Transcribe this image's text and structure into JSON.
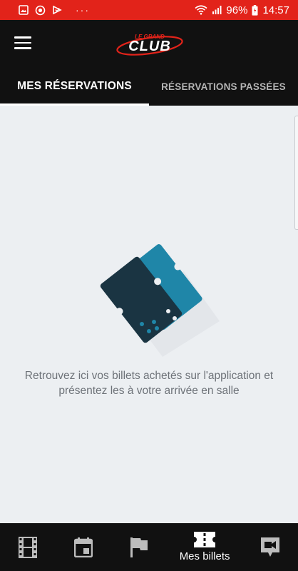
{
  "status_bar": {
    "battery": "96%",
    "time": "14:57",
    "dots": "···",
    "icons": [
      "image-icon",
      "app-icon",
      "download-icon",
      "wifi-icon",
      "signal-icon",
      "battery-icon"
    ]
  },
  "header": {
    "menu_icon": "hamburger-icon",
    "logo_top": "LE GRAND",
    "logo_main": "CLUB"
  },
  "tabs": [
    {
      "label": "MES RÉSERVATIONS",
      "active": true
    },
    {
      "label": "RÉSERVATIONS PASSÉES",
      "active": false
    }
  ],
  "main": {
    "empty_message_line1": "Retrouvez ici vos billets achetés sur l'application et",
    "empty_message_line2": "présentez les à votre arrivée en salle",
    "illustration_icon": "tickets-illustration"
  },
  "bottom_nav": [
    {
      "icon": "film-icon",
      "label": ""
    },
    {
      "icon": "calendar-icon",
      "label": ""
    },
    {
      "icon": "flag-icon",
      "label": ""
    },
    {
      "icon": "ticket-icon",
      "label": "Mes billets",
      "active": true
    },
    {
      "icon": "video-chat-icon",
      "label": ""
    }
  ],
  "colors": {
    "status_bar": "#e2231a",
    "header": "#111111",
    "background": "#eceff2",
    "ticket_dark": "#1a3442",
    "ticket_blue": "#1f86a8"
  }
}
